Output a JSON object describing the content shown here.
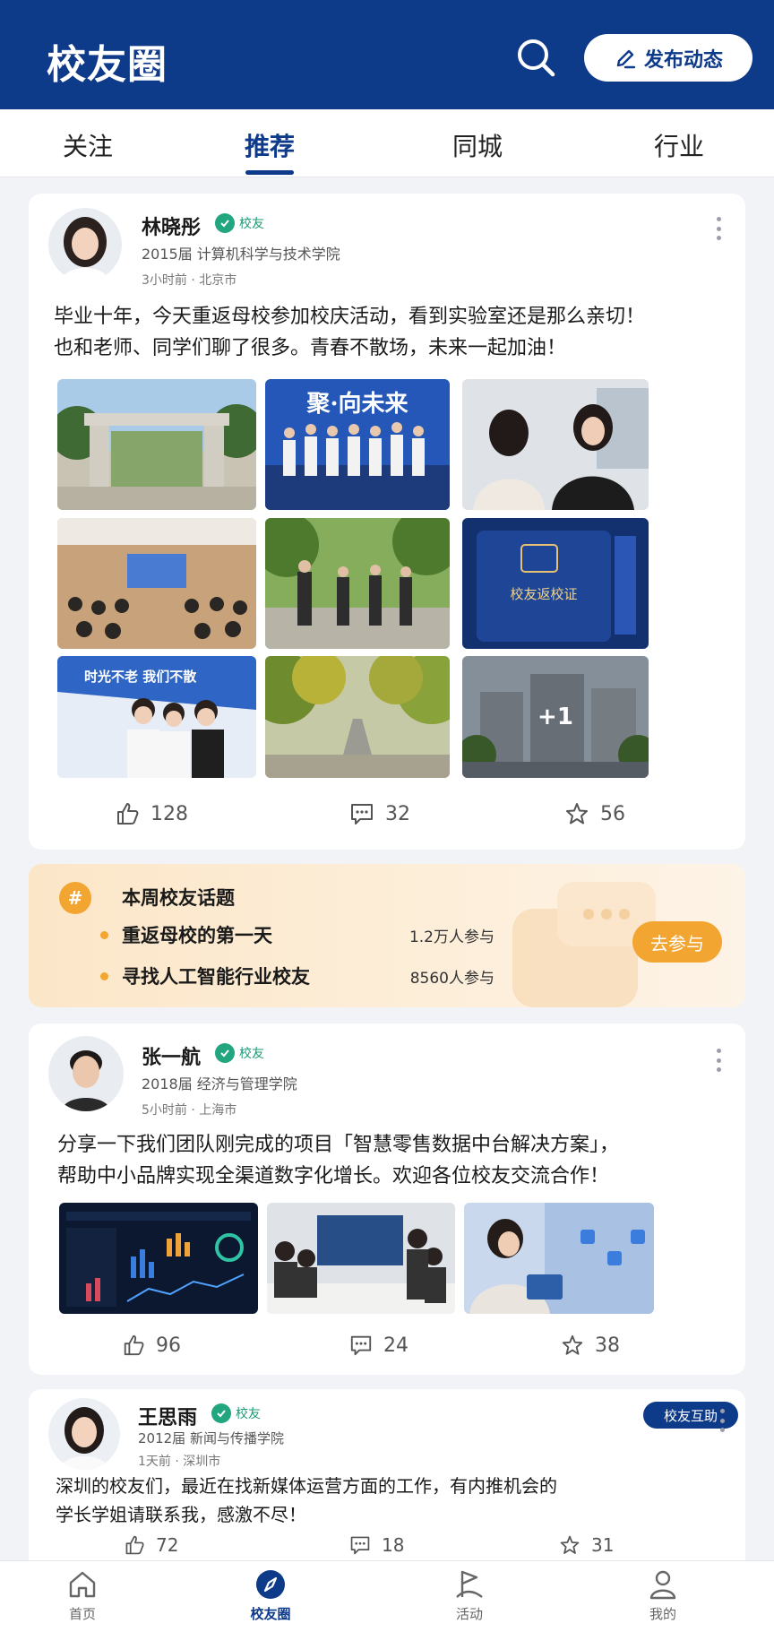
{
  "header": {
    "title": "校友圈",
    "publish_label": "发布动态"
  },
  "tabs": [
    {
      "label": "关注",
      "active": false
    },
    {
      "label": "推荐",
      "active": true
    },
    {
      "label": "同城",
      "active": false
    },
    {
      "label": "行业",
      "active": false
    }
  ],
  "posts": [
    {
      "name": "林晓彤",
      "badge": "校友",
      "info": "2015届  计算机科学与技术学院",
      "time": "3小时前 · 北京市",
      "text1": "毕业十年，今天重返母校参加校庆活动，看到实验室还是那么亲切！",
      "text2": "也和老师、同学们聊了很多。青春不散场，未来一起加油！",
      "images": [
        {
          "desc": "campus-gate",
          "label": ""
        },
        {
          "desc": "alumni-group-banner",
          "label": "聚·向未来"
        },
        {
          "desc": "two-women-talking",
          "label": ""
        },
        {
          "desc": "lecture-hall",
          "label": ""
        },
        {
          "desc": "group-walking-trees",
          "label": ""
        },
        {
          "desc": "alumni-pass-card",
          "label": "校友返校证"
        },
        {
          "desc": "selfie-banner",
          "label": "时光不老 我们不散"
        },
        {
          "desc": "tree-lined-road",
          "label": ""
        },
        {
          "desc": "campus-buildings",
          "label": ""
        }
      ],
      "extra_count": "+1",
      "likes": "128",
      "comments": "32",
      "stars": "56"
    },
    {
      "name": "张一航",
      "badge": "校友",
      "info": "2018届  经济与管理学院",
      "time": "5小时前 · 上海市",
      "text1": "分享一下我们团队刚完成的项目「智慧零售数据中台解决方案」，",
      "text2": "帮助中小品牌实现全渠道数字化增长。欢迎各位校友交流合作！",
      "likes": "96",
      "comments": "24",
      "stars": "38"
    },
    {
      "name": "王思雨",
      "badge": "校友",
      "info": "2012届  新闻与传播学院",
      "time": "1天前 · 深圳市",
      "tag": "校友互助",
      "text1": "深圳的校友们，最近在找新媒体运营方面的工作，有内推机会的",
      "text2": "学长学姐请联系我，感激不尽！",
      "likes": "72",
      "comments": "18",
      "stars": "31"
    }
  ],
  "topics": {
    "title": "本周校友话题",
    "items": [
      {
        "name": "重返母校的第一天",
        "count": "1.2万人参与"
      },
      {
        "name": "寻找人工智能行业校友",
        "count": "8560人参与"
      }
    ],
    "join_label": "去参与"
  },
  "bottom_nav": [
    {
      "label": "首页",
      "icon": "home-icon",
      "active": false
    },
    {
      "label": "校友圈",
      "icon": "compass-icon",
      "active": true
    },
    {
      "label": "活动",
      "icon": "flag-icon",
      "active": false
    },
    {
      "label": "我的",
      "icon": "user-icon",
      "active": false
    }
  ],
  "colors": {
    "primary": "#0e3a8a",
    "accent": "#f2a531",
    "verified": "#21a67f"
  }
}
